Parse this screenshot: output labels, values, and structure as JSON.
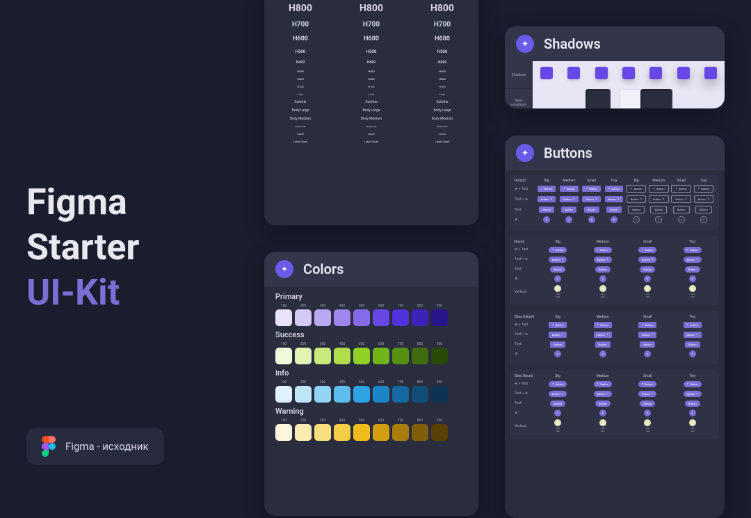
{
  "title": {
    "line1": "Figma",
    "line2": "Starter",
    "line3": "UI-Kit"
  },
  "figma_chip": "Figma - исходник",
  "typography": {
    "rows": [
      {
        "t": "H800",
        "fs": 14,
        "fw": 700,
        "mb": 10
      },
      {
        "t": "H700",
        "fs": 10,
        "fw": 700,
        "mb": 10
      },
      {
        "t": "H600",
        "fs": 9,
        "fw": 700,
        "mb": 10
      },
      {
        "t": "H500",
        "fs": 6,
        "fw": 600,
        "mb": 9
      },
      {
        "t": "H400",
        "fs": 5,
        "fw": 600,
        "mb": 7
      },
      {
        "t": "H300",
        "fs": 4,
        "fw": 600,
        "mb": 6
      },
      {
        "t": "H200",
        "fs": 4,
        "fw": 500,
        "mb": 6
      },
      {
        "t": "H100",
        "fs": 4,
        "fw": 400,
        "mb": 6
      },
      {
        "t": "Link",
        "fs": 4,
        "fw": 400,
        "mb": 6
      },
      {
        "t": "Subtitle",
        "fs": 5,
        "fw": 400,
        "mb": 6
      },
      {
        "t": "Body Large",
        "fs": 5,
        "fw": 400,
        "mb": 6
      },
      {
        "t": "Body Medium",
        "fs": 5,
        "fw": 400,
        "mb": 6
      },
      {
        "t": "Body small",
        "fs": 3,
        "fw": 400,
        "mb": 6
      },
      {
        "t": "Label",
        "fs": 4,
        "fw": 400,
        "mb": 6
      },
      {
        "t": "Label Small",
        "fs": 4,
        "fw": 400,
        "mb": 6
      }
    ]
  },
  "shadows": {
    "title": "Shadows",
    "tab1": "Shadows",
    "tab2": "Skeu-morphism"
  },
  "colors": {
    "title": "Colors",
    "steps": [
      "100",
      "200",
      "300",
      "400",
      "500",
      "600",
      "700",
      "800",
      "900"
    ],
    "sections": [
      {
        "name": "Primary",
        "swatches": [
          "#e8e3fa",
          "#d3caf6",
          "#baa9f2",
          "#9f86ee",
          "#866be8",
          "#6747e6",
          "#5131d9",
          "#3c22b9",
          "#29158a"
        ]
      },
      {
        "name": "Success",
        "swatches": [
          "#f0f9d9",
          "#e1f4b3",
          "#c8ea7a",
          "#aede4a",
          "#8fd124",
          "#71b418",
          "#579112",
          "#3f6c0d",
          "#2a4808"
        ]
      },
      {
        "name": "Info",
        "swatches": [
          "#e0f2fc",
          "#c0e5f9",
          "#93d3f5",
          "#5ebcee",
          "#2ea3e4",
          "#1a86c8",
          "#1569a2",
          "#104d79",
          "#0b3452"
        ]
      },
      {
        "name": "Warning",
        "swatches": [
          "#fdf6dc",
          "#fbecb3",
          "#f8de7d",
          "#f4ce46",
          "#efbc1a",
          "#d19f10",
          "#a87d0c",
          "#805d08",
          "#583f05"
        ]
      }
    ]
  },
  "buttons": {
    "title": "Buttons",
    "btn_label": "Button",
    "text_label": "Text",
    "sizes_full": [
      "Big",
      "Medium",
      "Small",
      "Tiny",
      "Big",
      "Medium",
      "Small",
      "Tiny"
    ],
    "sizes_half": [
      "Big",
      "Medium",
      "Small",
      "Tiny"
    ],
    "groups": [
      {
        "name": "Default",
        "rows": [
          "★ + Text",
          "Text + ★",
          "Text",
          "★"
        ]
      },
      {
        "name": "Round",
        "rows": [
          "★ + Text",
          "Text + ★",
          "Text",
          "★",
          "Vertical"
        ]
      },
      {
        "name": "Skeu Default",
        "rows": [
          "★ + Text",
          "Text + ★",
          "Text",
          "★"
        ]
      },
      {
        "name": "Skeu Round",
        "rows": [
          "★ + Text",
          "Text + ★",
          "Text",
          "★",
          "Vertical"
        ]
      }
    ]
  }
}
